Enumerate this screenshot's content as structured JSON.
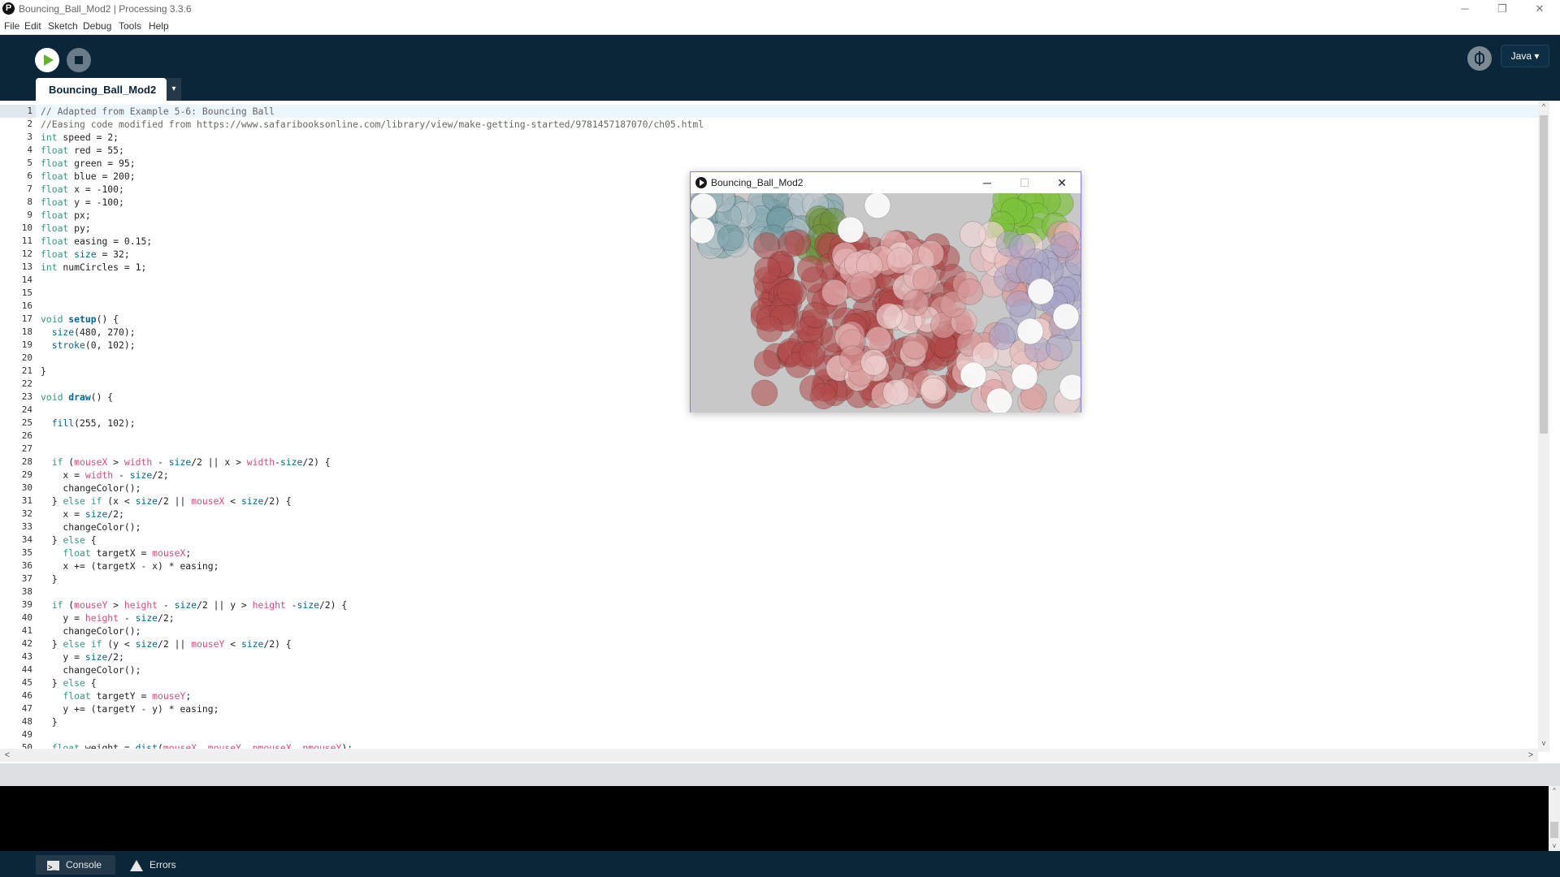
{
  "window": {
    "title": "Bouncing_Ball_Mod2 | Processing 3.3.6",
    "controls": {
      "minimize": "─",
      "restore": "❐",
      "close": "✕"
    }
  },
  "menu": [
    "File",
    "Edit",
    "Sketch",
    "Debug",
    "Tools",
    "Help"
  ],
  "toolbar": {
    "run_icon": "play-icon",
    "stop_icon": "stop-icon",
    "debugger_icon": "bug-icon",
    "mode_label": "Java ▾"
  },
  "tab": {
    "name": "Bouncing_Ball_Mod2",
    "menu_arrow": "▾"
  },
  "editor": {
    "current_line": 1,
    "line_numbers": [
      "1",
      "2",
      "3",
      "4",
      "5",
      "6",
      "7",
      "8",
      "9",
      "10",
      "11",
      "12",
      "13",
      "14",
      "15",
      "16",
      "17",
      "18",
      "19",
      "20",
      "21",
      "22",
      "23",
      "24",
      "25",
      "26",
      "27",
      "28",
      "29",
      "30",
      "31",
      "32",
      "33",
      "34",
      "35",
      "36",
      "37",
      "38",
      "39",
      "40",
      "41",
      "42",
      "43",
      "44",
      "45",
      "46",
      "47",
      "48",
      "49",
      "50"
    ],
    "code_lines": [
      "// Adapted from Example 5-6: Bouncing Ball",
      "//Easing code modified from https://www.safaribooksonline.com/library/view/make-getting-started/9781457187070/ch05.html",
      "int speed = 2;",
      "float red = 55;",
      "float green = 95;",
      "float blue = 200;",
      "float x = -100;",
      "float y = -100;",
      "float px;",
      "float py;",
      "float easing = 0.15;",
      "float size = 32;",
      "int numCircles = 1;",
      "",
      "",
      "",
      "void setup() {",
      "  size(480, 270);",
      "  stroke(0, 102);",
      "",
      "}",
      "",
      "void draw() {",
      "",
      "  fill(255, 102);",
      "",
      "",
      "  if (mouseX > width - size/2 || x > width-size/2) {",
      "    x = width - size/2;",
      "    changeColor();",
      "  } else if (x < size/2 || mouseX < size/2) {",
      "    x = size/2;",
      "    changeColor();",
      "  } else {",
      "    float targetX = mouseX;",
      "    x += (targetX - x) * easing;",
      "  }",
      "",
      "  if (mouseY > height - size/2 || y > height -size/2) {",
      "    y = height - size/2;",
      "    changeColor();",
      "  } else if (y < size/2 || mouseY < size/2) {",
      "    y = size/2;",
      "    changeColor();",
      "  } else {",
      "    float targetY = mouseY;",
      "    y += (targetY - y) * easing;",
      "  }",
      "",
      "  float weight = dist(mouseX, mouseY, pmouseX, pmouseY);"
    ]
  },
  "scroll": {
    "left": "<",
    "right": ">",
    "up": "^",
    "down": "v"
  },
  "sketch_window": {
    "title": "Bouncing_Ball_Mod2",
    "controls": {
      "minimize": "─",
      "maximize": "☐",
      "close": "✕"
    }
  },
  "footer": {
    "console_label": "Console",
    "errors_label": "Errors"
  },
  "colors": {
    "toolbar_bg": "#0b2638",
    "run_green": "#5eb22e",
    "keyword": "#33997e",
    "function": "#006699",
    "system_var": "#d94a7a"
  }
}
